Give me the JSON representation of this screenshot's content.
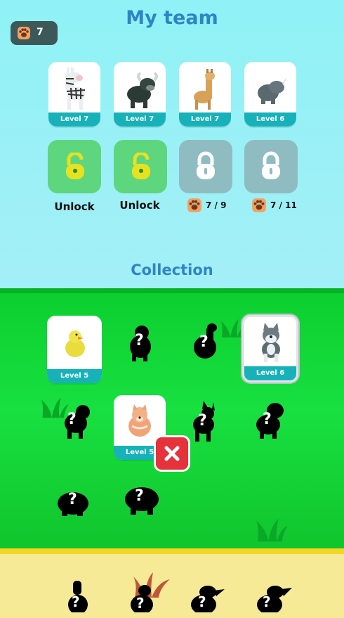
{
  "header": {
    "title": "My team",
    "paw_count": "7",
    "paw_icon": "paw-print-icon"
  },
  "team": [
    {
      "animal": "zebra",
      "level": "Level 7"
    },
    {
      "animal": "buffalo",
      "level": "Level 7"
    },
    {
      "animal": "llama",
      "level": "Level 7"
    },
    {
      "animal": "rhino",
      "level": "Level 6"
    }
  ],
  "slots": [
    {
      "state": "unlockable",
      "label": "Unlock"
    },
    {
      "state": "unlockable",
      "label": "Unlock"
    },
    {
      "state": "locked",
      "cost": "7 / 9"
    },
    {
      "state": "locked",
      "cost": "7 / 11"
    }
  ],
  "collection": {
    "title": "Collection",
    "cards": [
      {
        "animal": "chick",
        "level": "Level 5"
      },
      {
        "animal": "husky",
        "level": "Level 6",
        "selected": true
      },
      {
        "animal": "pomeranian",
        "level": "Level 5"
      }
    ],
    "unknown_marker": "?"
  },
  "colors": {
    "accent": "#2f84c5",
    "level_bar": "#17b2b9",
    "close": "#e5323b",
    "grass": "#18e040"
  }
}
